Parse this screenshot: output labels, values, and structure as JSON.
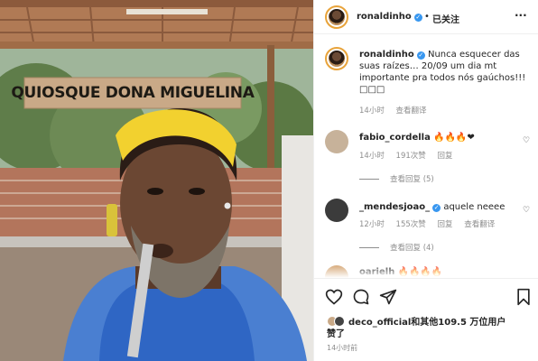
{
  "post": {
    "sign_text": "QUIOSQUE DONA MIGUELINA"
  },
  "header": {
    "username": "ronaldinho",
    "separator": "•",
    "follow_state": "已关注",
    "more_label": "···"
  },
  "caption": {
    "username": "ronaldinho",
    "text": "Nunca esquecer das suas raízes… 20/09 um dia mt importante pra todos nós gaúchos!!! □□□",
    "time": "14小时",
    "translate": "查看翻译"
  },
  "comments": [
    {
      "username": "fabio_cordella",
      "text": "🔥🔥🔥❤",
      "time": "14小时",
      "likes": "191次赞",
      "reply": "回复",
      "view_replies": "查看回复 (5)"
    },
    {
      "username": "_mendesjoao_",
      "text": "aquele neeee",
      "time": "12小时",
      "likes": "155次赞",
      "reply": "回复",
      "translate": "查看翻译",
      "view_replies": "查看回复 (4)"
    },
    {
      "username": "oarielh",
      "text": "🔥🔥🔥🔥"
    }
  ],
  "actions": {
    "likes_text_line1": "deco_official和其他109.5 万位用户",
    "likes_text_line2": "赞了",
    "time_ago": "14小时前"
  },
  "colors": {
    "verified": "#3897f0",
    "muted": "#8e8e8e",
    "text": "#262626"
  },
  "icons": [
    "heart-icon",
    "comment-icon",
    "share-icon",
    "bookmark-icon",
    "more-icon",
    "verified-icon"
  ]
}
